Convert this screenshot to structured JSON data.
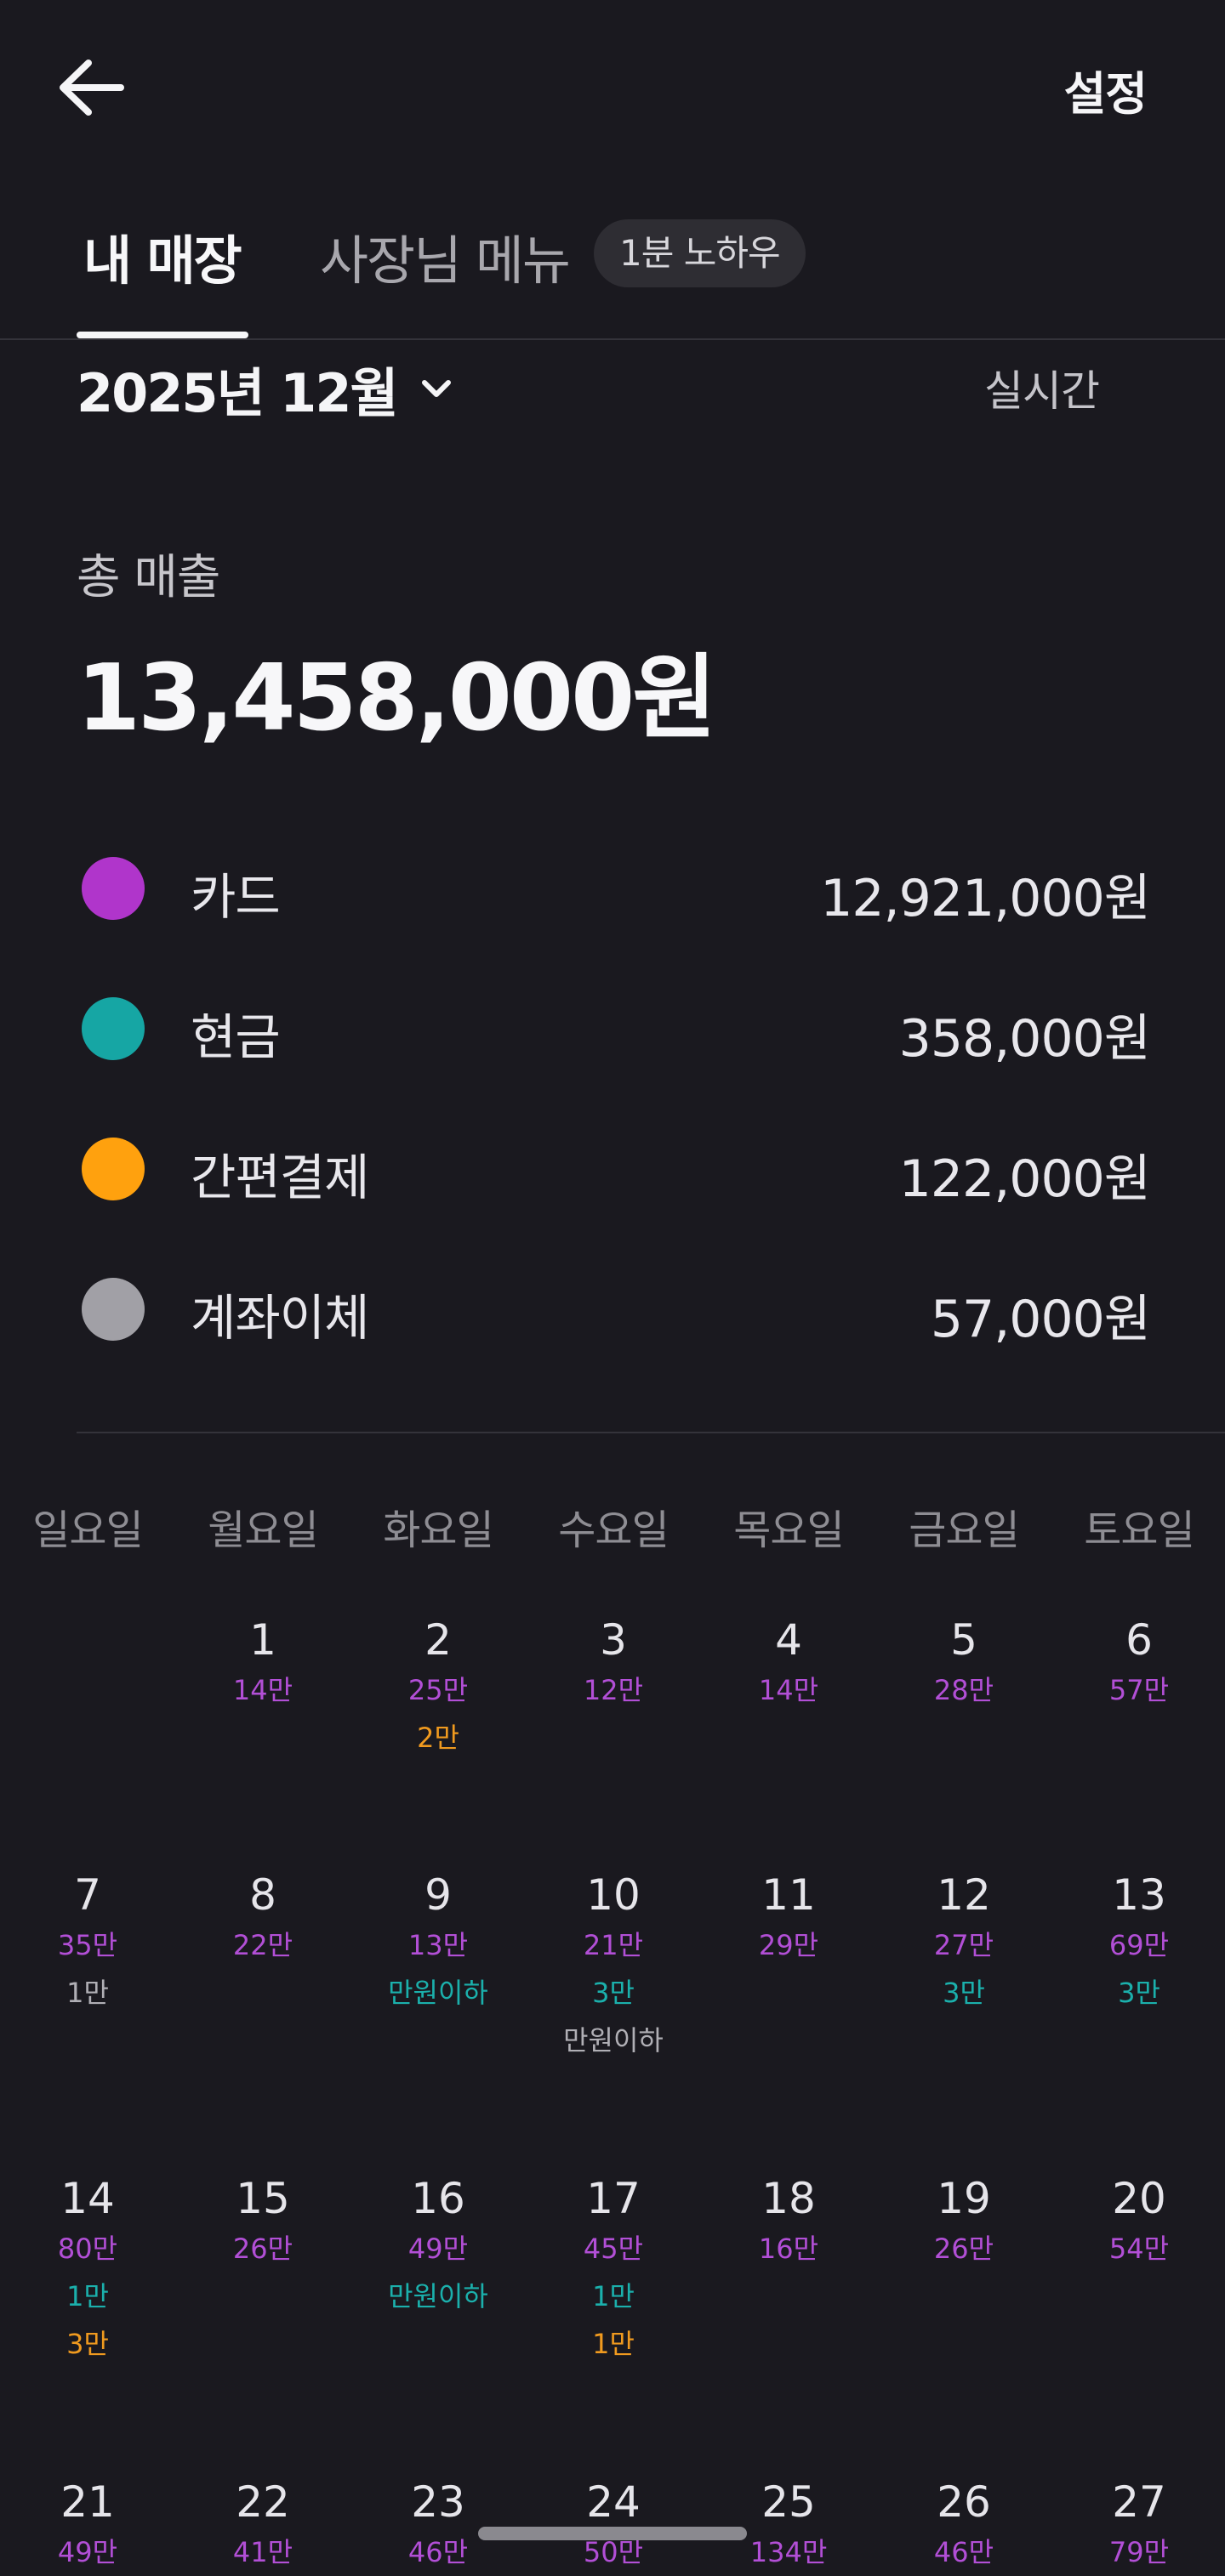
{
  "header": {
    "back_icon": "arrow-left-icon",
    "settings_label": "설정"
  },
  "tabs": {
    "mine_label": "내 매장",
    "owner_menu_label": "사장님 메뉴",
    "badge_label": "1분 노하우"
  },
  "period": {
    "month_label": "2025년 12월",
    "dropdown_icon": "chevron-down-icon",
    "realtime_label": "실시간"
  },
  "summary": {
    "total_label": "총 매출",
    "total_amount": "13,458,000원"
  },
  "payments": [
    {
      "name": "카드",
      "amount": "12,921,000원",
      "color": "#b035cb"
    },
    {
      "name": "현금",
      "amount": "358,000원",
      "color": "#16a6a4"
    },
    {
      "name": "간편결제",
      "amount": "122,000원",
      "color": "#ffa10e"
    },
    {
      "name": "계좌이체",
      "amount": "57,000원",
      "color": "#a1a0a6"
    }
  ],
  "colors": {
    "background": "#1a191f",
    "card": "#b24fd6",
    "cash": "#1bb0ac",
    "easy_pay": "#f09a1f",
    "transfer": "#b0afb5"
  },
  "calendar": {
    "weekdays": [
      "일요일",
      "월요일",
      "화요일",
      "수요일",
      "목요일",
      "금요일",
      "토요일"
    ],
    "weeks": [
      [
        null,
        {
          "day": "1",
          "lines": [
            {
              "text": "14만",
              "type": "card"
            }
          ]
        },
        {
          "day": "2",
          "lines": [
            {
              "text": "25만",
              "type": "card"
            },
            {
              "text": "2만",
              "type": "easy"
            }
          ]
        },
        {
          "day": "3",
          "lines": [
            {
              "text": "12만",
              "type": "card"
            }
          ]
        },
        {
          "day": "4",
          "lines": [
            {
              "text": "14만",
              "type": "card"
            }
          ]
        },
        {
          "day": "5",
          "lines": [
            {
              "text": "28만",
              "type": "card"
            }
          ]
        },
        {
          "day": "6",
          "lines": [
            {
              "text": "57만",
              "type": "card"
            }
          ]
        }
      ],
      [
        {
          "day": "7",
          "lines": [
            {
              "text": "35만",
              "type": "card"
            },
            {
              "text": "1만",
              "type": "transfer"
            }
          ]
        },
        {
          "day": "8",
          "lines": [
            {
              "text": "22만",
              "type": "card"
            }
          ]
        },
        {
          "day": "9",
          "lines": [
            {
              "text": "13만",
              "type": "card"
            },
            {
              "text": "만원이하",
              "type": "cash"
            }
          ]
        },
        {
          "day": "10",
          "lines": [
            {
              "text": "21만",
              "type": "card"
            },
            {
              "text": "3만",
              "type": "cash"
            },
            {
              "text": "만원이하",
              "type": "transfer"
            }
          ]
        },
        {
          "day": "11",
          "lines": [
            {
              "text": "29만",
              "type": "card"
            }
          ]
        },
        {
          "day": "12",
          "lines": [
            {
              "text": "27만",
              "type": "card"
            },
            {
              "text": "3만",
              "type": "cash"
            }
          ]
        },
        {
          "day": "13",
          "lines": [
            {
              "text": "69만",
              "type": "card"
            },
            {
              "text": "3만",
              "type": "cash"
            }
          ]
        }
      ],
      [
        {
          "day": "14",
          "lines": [
            {
              "text": "80만",
              "type": "card"
            },
            {
              "text": "1만",
              "type": "cash"
            },
            {
              "text": "3만",
              "type": "easy"
            }
          ]
        },
        {
          "day": "15",
          "lines": [
            {
              "text": "26만",
              "type": "card"
            }
          ]
        },
        {
          "day": "16",
          "lines": [
            {
              "text": "49만",
              "type": "card"
            },
            {
              "text": "만원이하",
              "type": "cash"
            }
          ]
        },
        {
          "day": "17",
          "lines": [
            {
              "text": "45만",
              "type": "card"
            },
            {
              "text": "1만",
              "type": "cash"
            },
            {
              "text": "1만",
              "type": "easy"
            }
          ]
        },
        {
          "day": "18",
          "lines": [
            {
              "text": "16만",
              "type": "card"
            }
          ]
        },
        {
          "day": "19",
          "lines": [
            {
              "text": "26만",
              "type": "card"
            }
          ]
        },
        {
          "day": "20",
          "lines": [
            {
              "text": "54만",
              "type": "card"
            }
          ]
        }
      ],
      [
        {
          "day": "21",
          "lines": [
            {
              "text": "49만",
              "type": "card"
            }
          ]
        },
        {
          "day": "22",
          "lines": [
            {
              "text": "41만",
              "type": "card"
            }
          ]
        },
        {
          "day": "23",
          "lines": [
            {
              "text": "46만",
              "type": "card"
            }
          ]
        },
        {
          "day": "24",
          "lines": [
            {
              "text": "50만",
              "type": "card"
            }
          ]
        },
        {
          "day": "25",
          "lines": [
            {
              "text": "134만",
              "type": "card"
            }
          ]
        },
        {
          "day": "26",
          "lines": [
            {
              "text": "46만",
              "type": "card"
            }
          ]
        },
        {
          "day": "27",
          "lines": [
            {
              "text": "79만",
              "type": "card"
            }
          ]
        }
      ]
    ]
  }
}
